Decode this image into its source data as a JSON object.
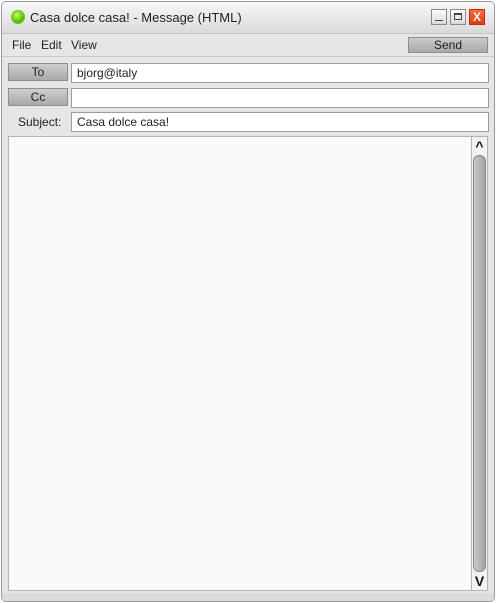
{
  "window": {
    "title": "Casa dolce casa! - Message (HTML)",
    "controls": {
      "minimize": "",
      "maximize": "",
      "close": "X"
    }
  },
  "menu": {
    "items": [
      {
        "label": "File"
      },
      {
        "label": "Edit"
      },
      {
        "label": "View"
      }
    ],
    "send_label": "Send"
  },
  "compose": {
    "to_label": "To",
    "to_value": "bjorg@italy",
    "cc_label": "Cc",
    "cc_value": "",
    "subject_label": "Subject:",
    "subject_value": "Casa dolce casa!"
  },
  "scrollbar": {
    "up_icon": "^",
    "down_icon": "V"
  },
  "icons": {
    "app_icon": "green-status-icon"
  },
  "colors": {
    "close_button": "#e23b10",
    "app_icon": "#55c400"
  }
}
